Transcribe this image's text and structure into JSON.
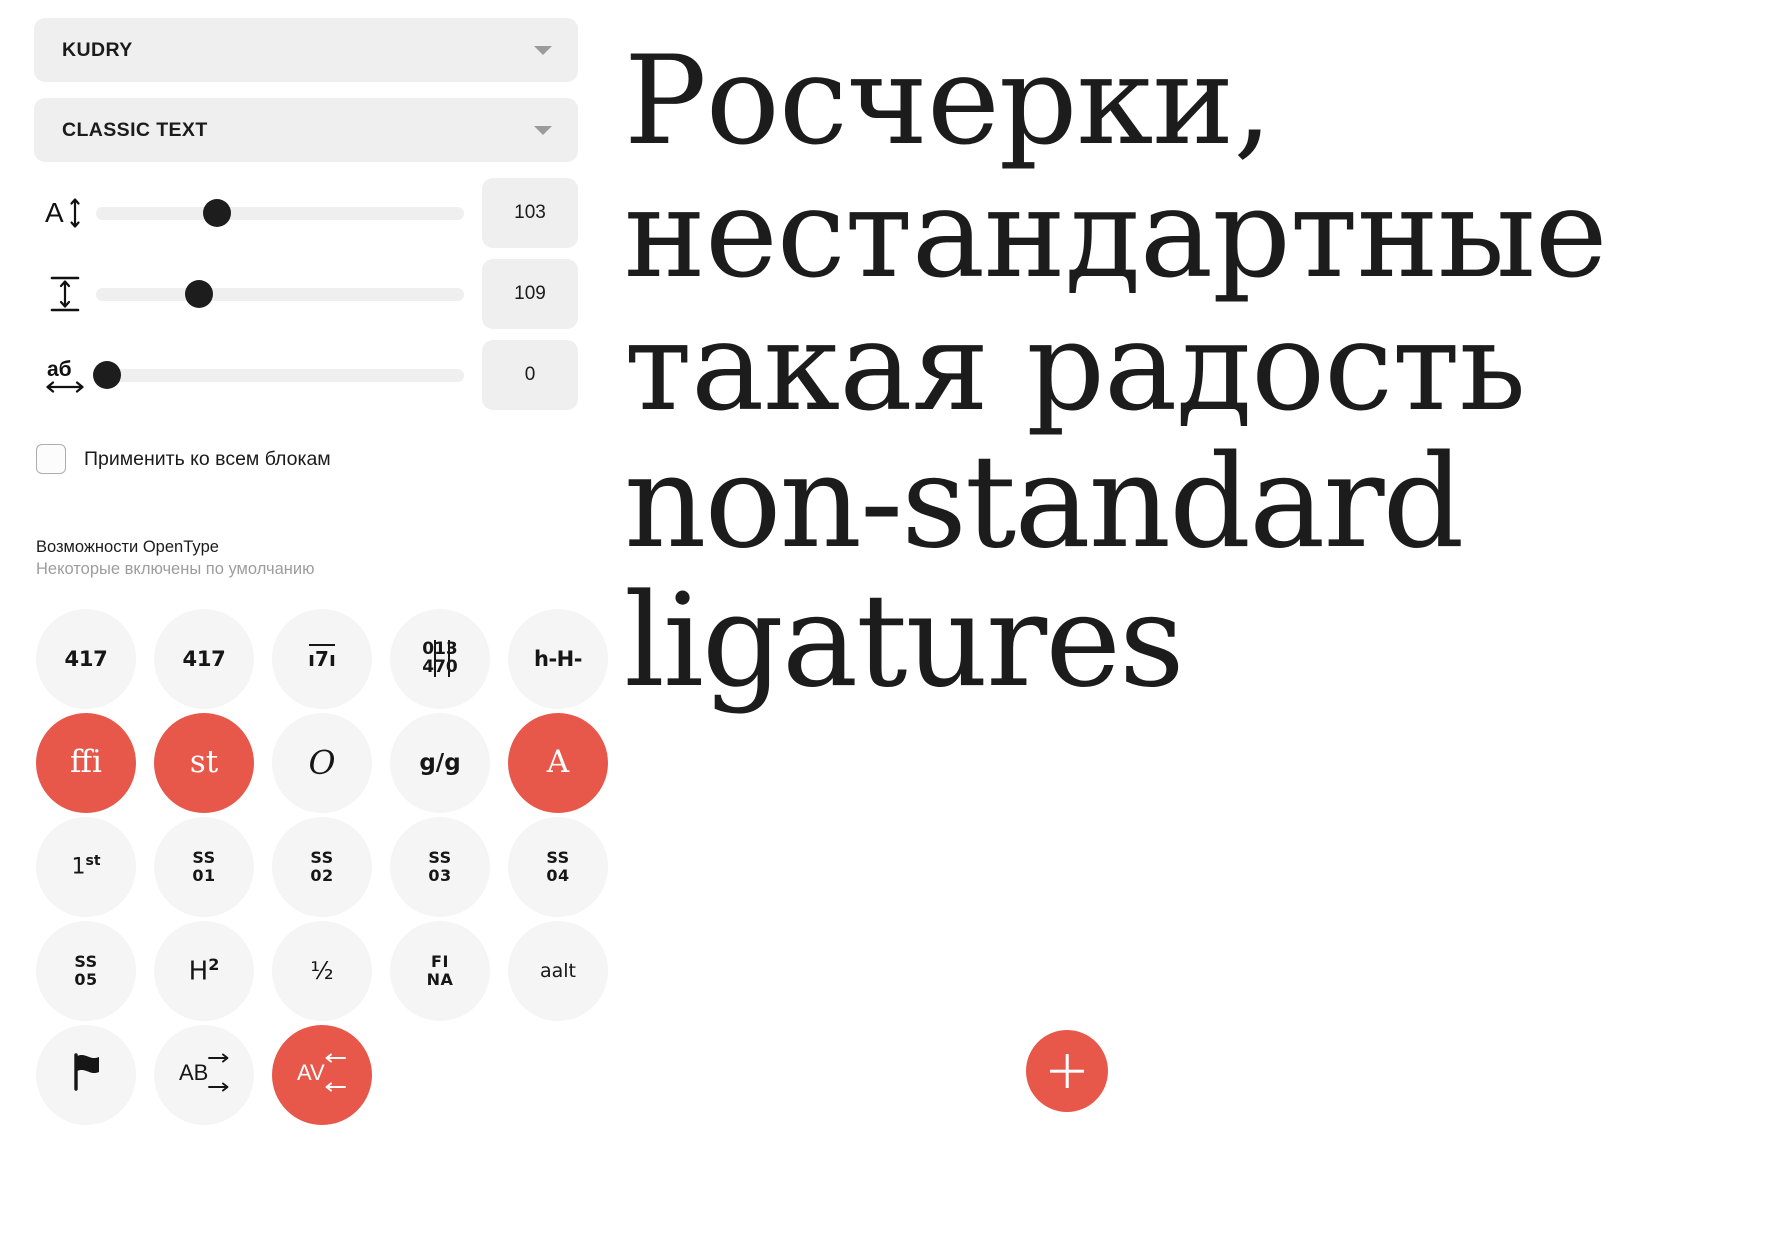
{
  "panel": {
    "dropdowns": [
      {
        "name": "font-family",
        "value": "KUDRY",
        "icon": "chevron-down-icon"
      },
      {
        "name": "font-style",
        "value": "CLASSIC TEXT",
        "icon": "chevron-down-icon"
      }
    ],
    "sliders": [
      {
        "name": "font-size",
        "icon": "font-size-icon",
        "value": "103",
        "percent": 33
      },
      {
        "name": "line-height",
        "icon": "line-height-icon",
        "value": "109",
        "percent": 28
      },
      {
        "name": "letter-spacing",
        "icon": "letter-spacing-icon",
        "value": "0",
        "percent": 3
      }
    ],
    "checkbox": {
      "label": "Применить ко всем блокам",
      "checked": false
    },
    "opentype": {
      "title": "Возможности OpenType",
      "subtitle": "Некоторые включены по умолчанию",
      "features": [
        {
          "id": "tnum",
          "glyph": "417",
          "kind": "num",
          "active": false
        },
        {
          "id": "onum",
          "glyph": "417",
          "kind": "osf",
          "active": false
        },
        {
          "id": "zero",
          "glyph": "ı7ı",
          "kind": "ovr",
          "active": false
        },
        {
          "id": "frac",
          "glyph": "013 470",
          "kind": "numgrid",
          "active": false
        },
        {
          "id": "case",
          "glyph": "h-H-",
          "kind": "hyph",
          "active": false
        },
        {
          "id": "liga",
          "glyph": "ffi",
          "kind": "lig",
          "active": true
        },
        {
          "id": "dlig",
          "glyph": "st",
          "kind": "lig",
          "active": true
        },
        {
          "id": "swsh",
          "glyph": "𝒪",
          "kind": "swash",
          "active": false
        },
        {
          "id": "salt",
          "glyph": "g/g",
          "kind": "gg",
          "active": false
        },
        {
          "id": "cswh",
          "glyph": "Ʌ",
          "kind": "alt",
          "active": true
        },
        {
          "id": "ordn",
          "glyph": "1st",
          "kind": "ord",
          "active": false
        },
        {
          "id": "ss01",
          "glyph": "SS 01",
          "kind": "ss",
          "active": false
        },
        {
          "id": "ss02",
          "glyph": "SS 02",
          "kind": "ss",
          "active": false
        },
        {
          "id": "ss03",
          "glyph": "SS 03",
          "kind": "ss",
          "active": false
        },
        {
          "id": "ss04",
          "glyph": "SS 04",
          "kind": "ss",
          "active": false
        },
        {
          "id": "ss05",
          "glyph": "SS 05",
          "kind": "ss",
          "active": false
        },
        {
          "id": "sups",
          "glyph": "H2",
          "kind": "sup",
          "active": false
        },
        {
          "id": "half",
          "glyph": "½",
          "kind": "frac",
          "active": false
        },
        {
          "id": "fina",
          "glyph": "FI NA",
          "kind": "ss",
          "active": false
        },
        {
          "id": "aalt",
          "glyph": "aalt",
          "kind": "aalt",
          "active": false
        },
        {
          "id": "flag",
          "glyph": "⚑",
          "kind": "flag",
          "active": false
        },
        {
          "id": "tracking-out",
          "glyph": "AB",
          "kind": "track-out",
          "active": false
        },
        {
          "id": "kern",
          "glyph": "AV",
          "kind": "track-in",
          "active": true
        }
      ]
    }
  },
  "canvas": {
    "specimen_lines": [
      "Росчерки,",
      "нестандартные",
      "такая радость",
      "non-standard",
      "ligatures"
    ],
    "fab": {
      "label": "+",
      "icon": "plus-icon"
    }
  },
  "colors": {
    "accent": "#E8584A",
    "panel_fill": "#EFEFEF",
    "chip_fill": "#F5F5F5",
    "text": "#1B1B1B",
    "muted": "#9D9D9D"
  }
}
